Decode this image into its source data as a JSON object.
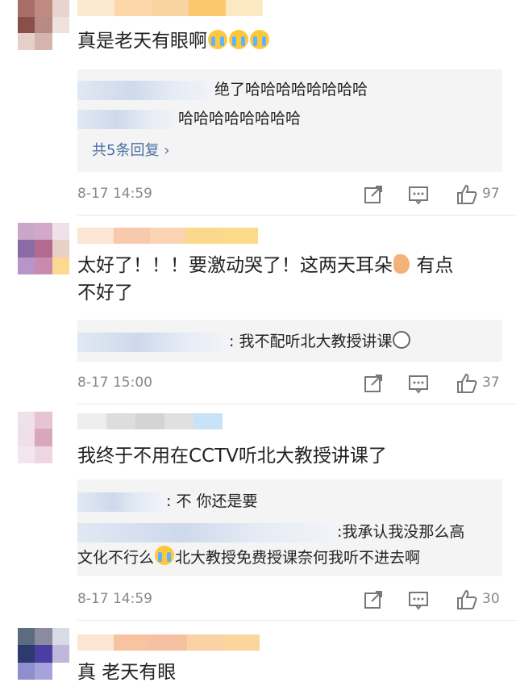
{
  "comments": [
    {
      "text_parts": [
        "真是老天有眼啊"
      ],
      "emoji_after": [
        "crying-emoji",
        "crying-emoji",
        "crying-emoji"
      ],
      "replies": [
        {
          "text": "绝了哈哈哈哈哈哈哈哈"
        },
        {
          "text": "哈哈哈哈哈哈哈哈"
        }
      ],
      "more_replies": "共5条回复",
      "time": "8-17 14:59",
      "likes": "97"
    },
    {
      "text_line1": "太好了！！！要激动哭了！这两天耳朵",
      "text_line1_after": "有点",
      "text_line2": "不好了",
      "replies": [
        {
          "text": ": 我不配听北大教授讲课"
        }
      ],
      "time": "8-17 15:00",
      "likes": "37"
    },
    {
      "text": "我终于不用在CCTV听北大教授讲课了",
      "replies": [
        {
          "text": ": 不 你还是要"
        },
        {
          "text": ":我承认我没那么高"
        },
        {
          "text_before_emoji": "文化不行么",
          "text_after_emoji": "北大教授免费授课奈何我听不进去啊"
        }
      ],
      "time": "8-17 14:59",
      "likes": "30"
    },
    {
      "text": "真 老天有眼"
    }
  ],
  "icons": {
    "share": "share-icon",
    "comment": "comment-icon",
    "like": "thumbs-up-icon"
  },
  "colors": {
    "link": "#4a6fa5",
    "meta": "#888888",
    "reply_bg": "#f4f4f4"
  }
}
